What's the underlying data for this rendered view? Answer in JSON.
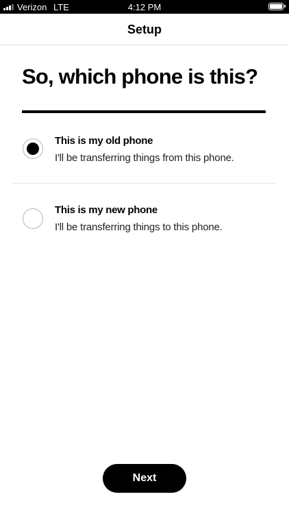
{
  "status_bar": {
    "carrier": "Verizon",
    "network": "LTE",
    "time": "4:12 PM"
  },
  "header": {
    "title": "Setup"
  },
  "main": {
    "heading": "So, which phone is this?",
    "options": [
      {
        "label": "This is my old phone",
        "description": "I'll be transferring things from this phone.",
        "selected": true
      },
      {
        "label": "This is my new phone",
        "description": "I'll be transferring things to this phone.",
        "selected": false
      }
    ]
  },
  "footer": {
    "next_label": "Next"
  }
}
